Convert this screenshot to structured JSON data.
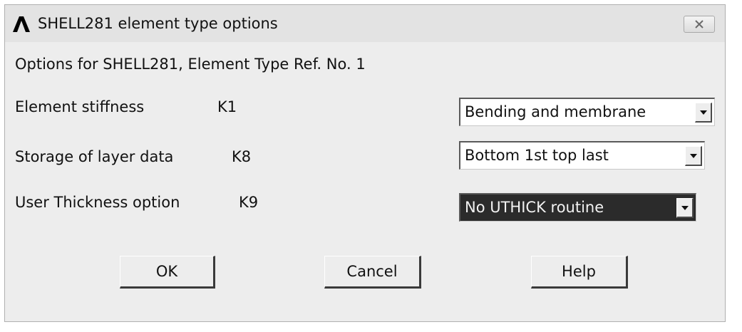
{
  "window": {
    "title": "SHELL281 element type options",
    "app_icon": "ansys-logo-icon",
    "close_icon": "close-icon"
  },
  "heading": "Options for SHELL281, Element Type Ref. No. 1",
  "options": [
    {
      "label": "Element stiffness",
      "key": "K1",
      "value": "Bending and membrane"
    },
    {
      "label": "Storage of layer data",
      "key": "K8",
      "value": "Bottom 1st top last"
    },
    {
      "label": "User Thickness option",
      "key": "K9",
      "value": "No UTHICK routine"
    }
  ],
  "buttons": {
    "ok": "OK",
    "cancel": "Cancel",
    "help": "Help"
  }
}
